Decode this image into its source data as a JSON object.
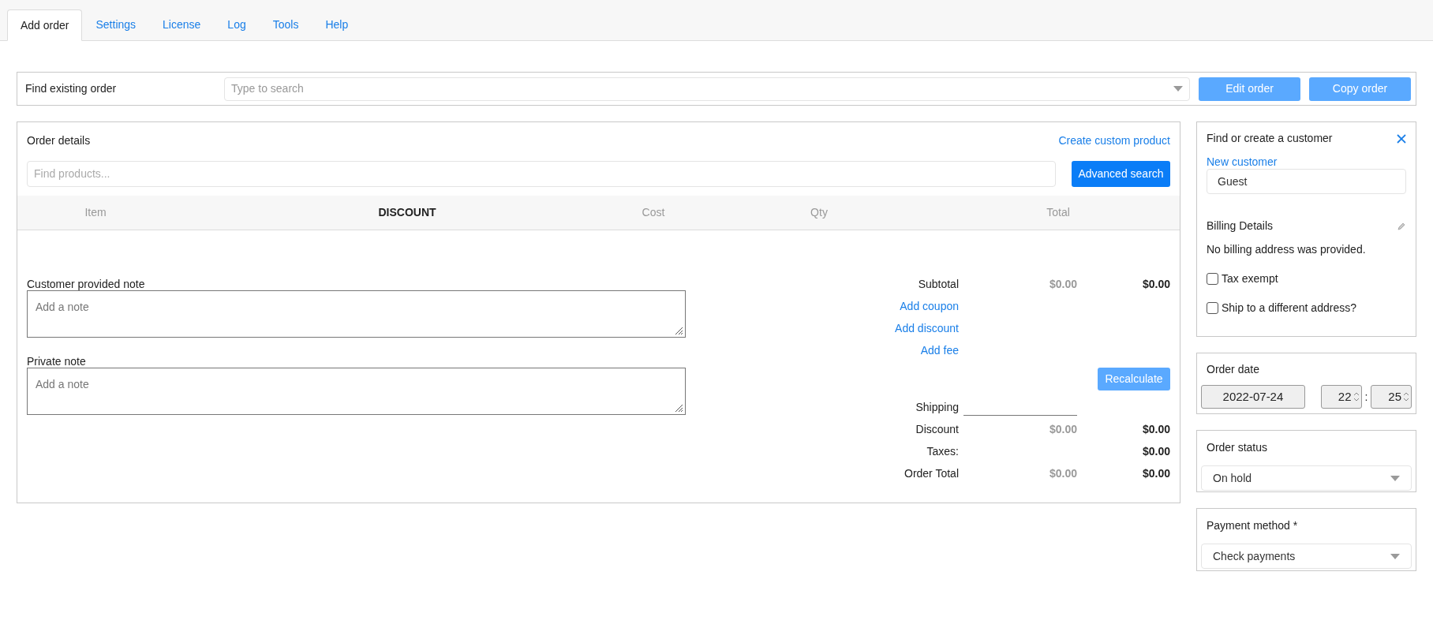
{
  "tabs": [
    {
      "label": "Add order",
      "selected": true
    },
    {
      "label": "Settings",
      "selected": false
    },
    {
      "label": "License",
      "selected": false
    },
    {
      "label": "Log",
      "selected": false
    },
    {
      "label": "Tools",
      "selected": false
    },
    {
      "label": "Help",
      "selected": false
    }
  ],
  "find_order": {
    "label": "Find existing order",
    "placeholder": "Type to search",
    "buttons": [
      "Edit order",
      "Copy order"
    ]
  },
  "order_details": {
    "title": "Order details",
    "create_link": "Create custom product",
    "product_search": {
      "placeholder": "Find products..."
    },
    "advanced_button": "Advanced search",
    "columns": [
      {
        "label": "Item",
        "bold": false
      },
      {
        "label": "DISCOUNT",
        "bold": true
      },
      {
        "label": "Cost",
        "bold": false
      },
      {
        "label": "Qty",
        "bold": false
      },
      {
        "label": "Total",
        "bold": false
      }
    ],
    "notes": [
      {
        "label": "Customer provided note",
        "placeholder": "Add a note"
      },
      {
        "label": "Private note",
        "placeholder": "Add a note"
      }
    ],
    "totals": [
      {
        "kind": "row",
        "label": "Subtotal",
        "value_1": "$0.00",
        "value_2": "$0.00"
      },
      {
        "kind": "link",
        "label": "Add coupon"
      },
      {
        "kind": "link",
        "label": "Add discount"
      },
      {
        "kind": "link",
        "label": "Add fee"
      },
      {
        "kind": "button",
        "label": "Recalculate"
      },
      {
        "kind": "input",
        "label": "Shipping"
      },
      {
        "kind": "row",
        "label": "Discount",
        "value_1": "$0.00",
        "value_2": "$0.00"
      },
      {
        "kind": "row",
        "label": "Taxes:",
        "value_2": "$0.00"
      },
      {
        "kind": "row",
        "label": "Order Total",
        "value_1": "$0.00",
        "value_2": "$0.00"
      }
    ]
  },
  "customer": {
    "title": "Find or create a customer",
    "new_link": "New customer",
    "value": "Guest",
    "billing_title": "Billing Details",
    "billing_text": "No billing address was provided.",
    "checkboxes": [
      {
        "label": "Tax exempt",
        "checked": false
      },
      {
        "label": "Ship to a different address?",
        "checked": false
      }
    ]
  },
  "order_date": {
    "title": "Order date",
    "date": "2022-07-24",
    "hour": "22",
    "separator": ":",
    "minute": "25"
  },
  "order_status": {
    "title": "Order status",
    "value": "On hold"
  },
  "payment": {
    "title": "Payment method *",
    "value": "Check payments"
  }
}
